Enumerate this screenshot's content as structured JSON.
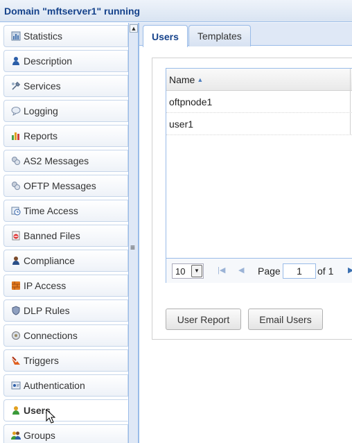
{
  "window": {
    "title": "Domain \"mftserver1\" running"
  },
  "sidebar": {
    "items": [
      {
        "label": "Statistics",
        "icon": "statistics-icon"
      },
      {
        "label": "Description",
        "icon": "person-icon"
      },
      {
        "label": "Services",
        "icon": "services-icon"
      },
      {
        "label": "Logging",
        "icon": "logging-icon"
      },
      {
        "label": "Reports",
        "icon": "reports-icon"
      },
      {
        "label": "AS2 Messages",
        "icon": "as2-messages-icon"
      },
      {
        "label": "OFTP Messages",
        "icon": "oftp-messages-icon"
      },
      {
        "label": "Time Access",
        "icon": "time-access-icon"
      },
      {
        "label": "Banned Files",
        "icon": "banned-files-icon"
      },
      {
        "label": "Compliance",
        "icon": "compliance-icon"
      },
      {
        "label": "IP Access",
        "icon": "ip-access-icon"
      },
      {
        "label": "DLP Rules",
        "icon": "dlp-rules-icon"
      },
      {
        "label": "Connections",
        "icon": "connections-icon"
      },
      {
        "label": "Triggers",
        "icon": "triggers-icon"
      },
      {
        "label": "Authentication",
        "icon": "authentication-icon"
      },
      {
        "label": "Users",
        "icon": "users-icon",
        "active": true
      },
      {
        "label": "Groups",
        "icon": "groups-icon"
      }
    ]
  },
  "tabs": [
    {
      "label": "Users",
      "active": true
    },
    {
      "label": "Templates",
      "active": false
    }
  ],
  "grid": {
    "column": "Name",
    "rows": [
      "oftpnode1",
      "user1"
    ]
  },
  "pager": {
    "page_size": "10",
    "page_label": "Page",
    "current_page": "1",
    "of_label": "of 1"
  },
  "buttons": {
    "user_report": "User Report",
    "email_users": "Email Users"
  },
  "colors": {
    "accent": "#15428b",
    "border": "#99bbe8",
    "header_bg": "#dfe8f6"
  }
}
